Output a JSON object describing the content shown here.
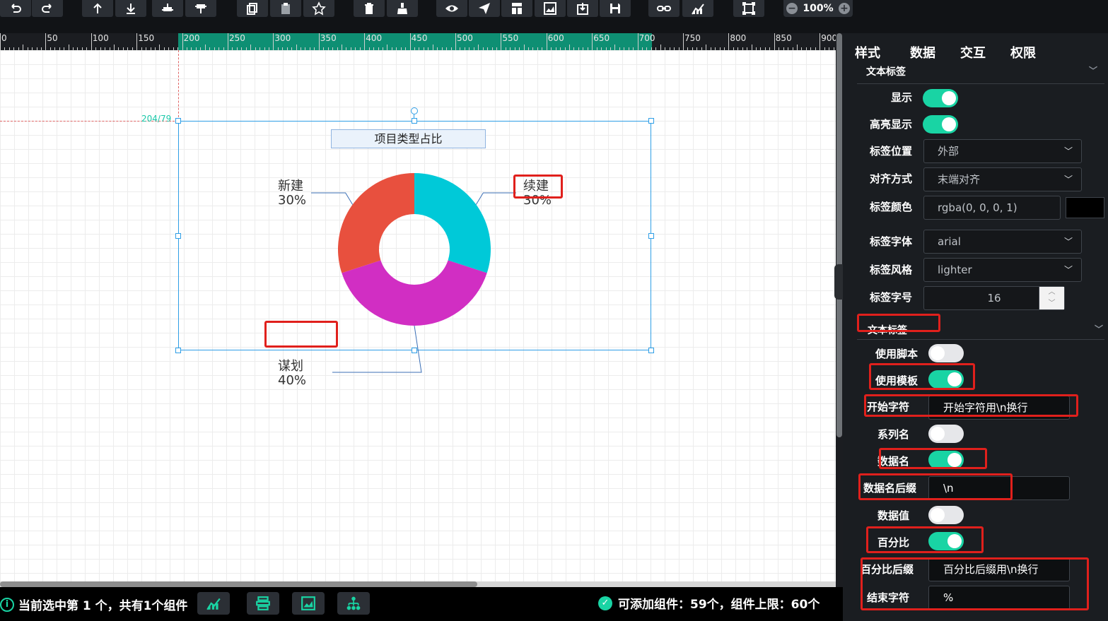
{
  "toolbar": {
    "buttons": [
      "undo-icon",
      "redo-icon",
      "move-up-icon",
      "move-down-icon",
      "align-top-icon",
      "align-bottom-icon",
      "copy-icon",
      "paste-icon",
      "favorite-icon",
      "delete-icon",
      "clear-icon",
      "preview-icon",
      "publish-icon",
      "template-icon",
      "image-icon",
      "export-icon",
      "save-icon",
      "link-icon",
      "chart-icon",
      "fullscreen-icon"
    ],
    "zoom": "100%"
  },
  "ruler": {
    "labels": [
      "0",
      "50",
      "100",
      "150",
      "200",
      "250",
      "300",
      "350",
      "400",
      "450",
      "500",
      "550",
      "600",
      "650",
      "700",
      "750",
      "800",
      "850",
      "900"
    ]
  },
  "canvas": {
    "coord": "204/79",
    "chart_data": {
      "type": "pie",
      "title": "项目类型占比",
      "categories": [
        "续建",
        "谋划",
        "新建"
      ],
      "values": [
        30,
        40,
        30
      ],
      "value_suffix": "%",
      "colors": [
        "#00c9d8",
        "#d12ec3",
        "#e8503e"
      ],
      "donut": true
    }
  },
  "status": {
    "selection": "当前选中第 1 个，共有1个组件",
    "capacity": "可添加组件：59个，组件上限：60个"
  },
  "panel": {
    "tabs": [
      "样式",
      "数据",
      "交互",
      "权限"
    ],
    "section1_title": "文本标签",
    "show_label": "显示",
    "highlight_label": "高亮显示",
    "position_label": "标签位置",
    "position_value": "外部",
    "align_label": "对齐方式",
    "align_value": "末端对齐",
    "color_label": "标签颜色",
    "color_value": "rgba(0, 0, 0, 1)",
    "font_label": "标签字体",
    "font_value": "arial",
    "style_label": "标签风格",
    "style_value": "lighter",
    "size_label": "标签字号",
    "size_value": "16",
    "section2_title": "文本标签",
    "use_script": "使用脚本",
    "use_template": "使用模板",
    "start_char": "开始字符",
    "start_char_value": "开始字符用\\n换行",
    "series_name": "系列名",
    "data_name": "数据名",
    "data_name_suffix": "数据名后缀",
    "data_name_suffix_value": "\\n",
    "data_value": "数据值",
    "percent": "百分比",
    "percent_suffix": "百分比后缀",
    "percent_suffix_value": "百分比后缀用\\n换行",
    "end_char": "结束字符",
    "end_char_value": "%"
  }
}
